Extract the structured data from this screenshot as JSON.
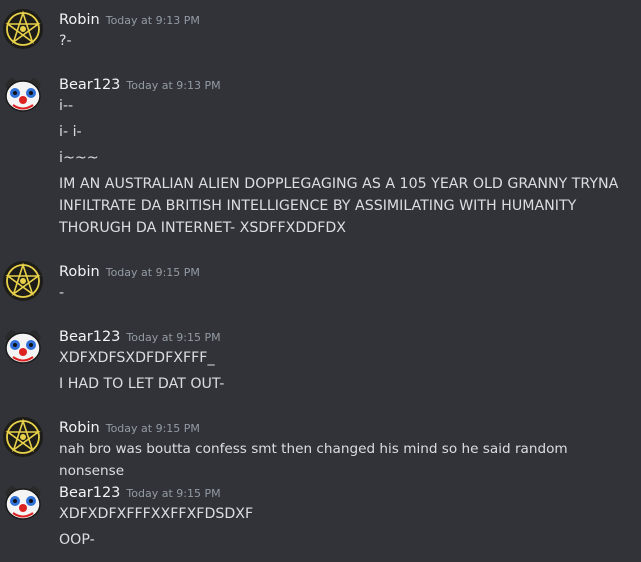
{
  "messages": [
    {
      "author": "Robin",
      "timestamp": "Today at 9:13 PM",
      "lines": [
        "?-"
      ]
    },
    {
      "author": "Bear123",
      "timestamp": "Today at 9:13 PM",
      "lines": [
        "i--",
        "i- i-",
        "i~~~",
        "IM AN AUSTRALIAN ALIEN DOPPLEGAGING AS A 105 YEAR OLD GRANNY TRYNA INFILTRATE DA BRITISH INTELLIGENCE BY ASSIMILATING WITH HUMANITY THORUGH DA INTERNET- XSDFFXDDFDX"
      ]
    },
    {
      "author": "Robin",
      "timestamp": "Today at 9:15 PM",
      "lines": [
        "-"
      ]
    },
    {
      "author": "Bear123",
      "timestamp": "Today at 9:15 PM",
      "lines": [
        "XDFXDFSXDFDFXFFF_",
        "I HAD TO LET DAT OUT-"
      ]
    },
    {
      "author": "Robin",
      "timestamp": "Today at 9:15 PM",
      "lines": [
        "nah bro was boutta confess smt then changed his mind so he said random nonsense"
      ]
    },
    {
      "author": "Bear123",
      "timestamp": "Today at 9:15 PM",
      "lines": [
        "XDFXDFXFFFXXFFXFDSDXF",
        "OOP-"
      ]
    }
  ],
  "colors": {
    "background": "#313338",
    "username": "#f2f3f5",
    "timestamp": "#949ba4",
    "text": "#dbdee1"
  },
  "avatars": {
    "Robin": "yellow-pentagram-avatar",
    "Bear123": "clown-bear-avatar"
  }
}
